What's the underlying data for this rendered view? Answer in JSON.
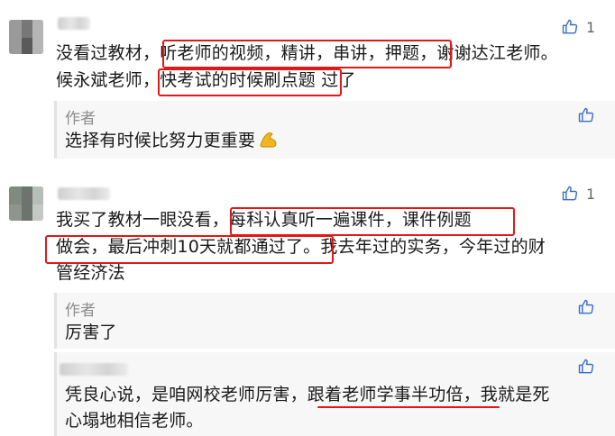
{
  "comments": [
    {
      "text_lines": [
        "没看过教材，听老师的视频，精讲，串讲，押题，谢谢达江老师。",
        "候永斌老师，快考试的时候刷点题  过了"
      ],
      "likes": "1",
      "reply": {
        "author": "作者",
        "text": "选择有时候比努力更重要"
      }
    },
    {
      "text_lines": [
        "我买了教材一眼没看，每科认真听一遍课件，课件例题",
        "做会，最后冲刺10天就都通过了。我去年过的实务，今年过的财",
        "管经济法"
      ],
      "likes": "1",
      "reply": {
        "author": "作者",
        "text": "厉害了"
      }
    },
    {
      "text_lines": [
        "凭良心说，是咱网校老师厉害，跟着老师学事半功倍，我就是死",
        "心塌地相信老师。"
      ]
    }
  ],
  "icons": {
    "like": "thumbs-up-icon",
    "emoji": "flexed-biceps-emoji"
  },
  "colors": {
    "highlight": "#e01818",
    "reply_bg": "#f7f7f7",
    "muted": "#8c8c8c"
  }
}
